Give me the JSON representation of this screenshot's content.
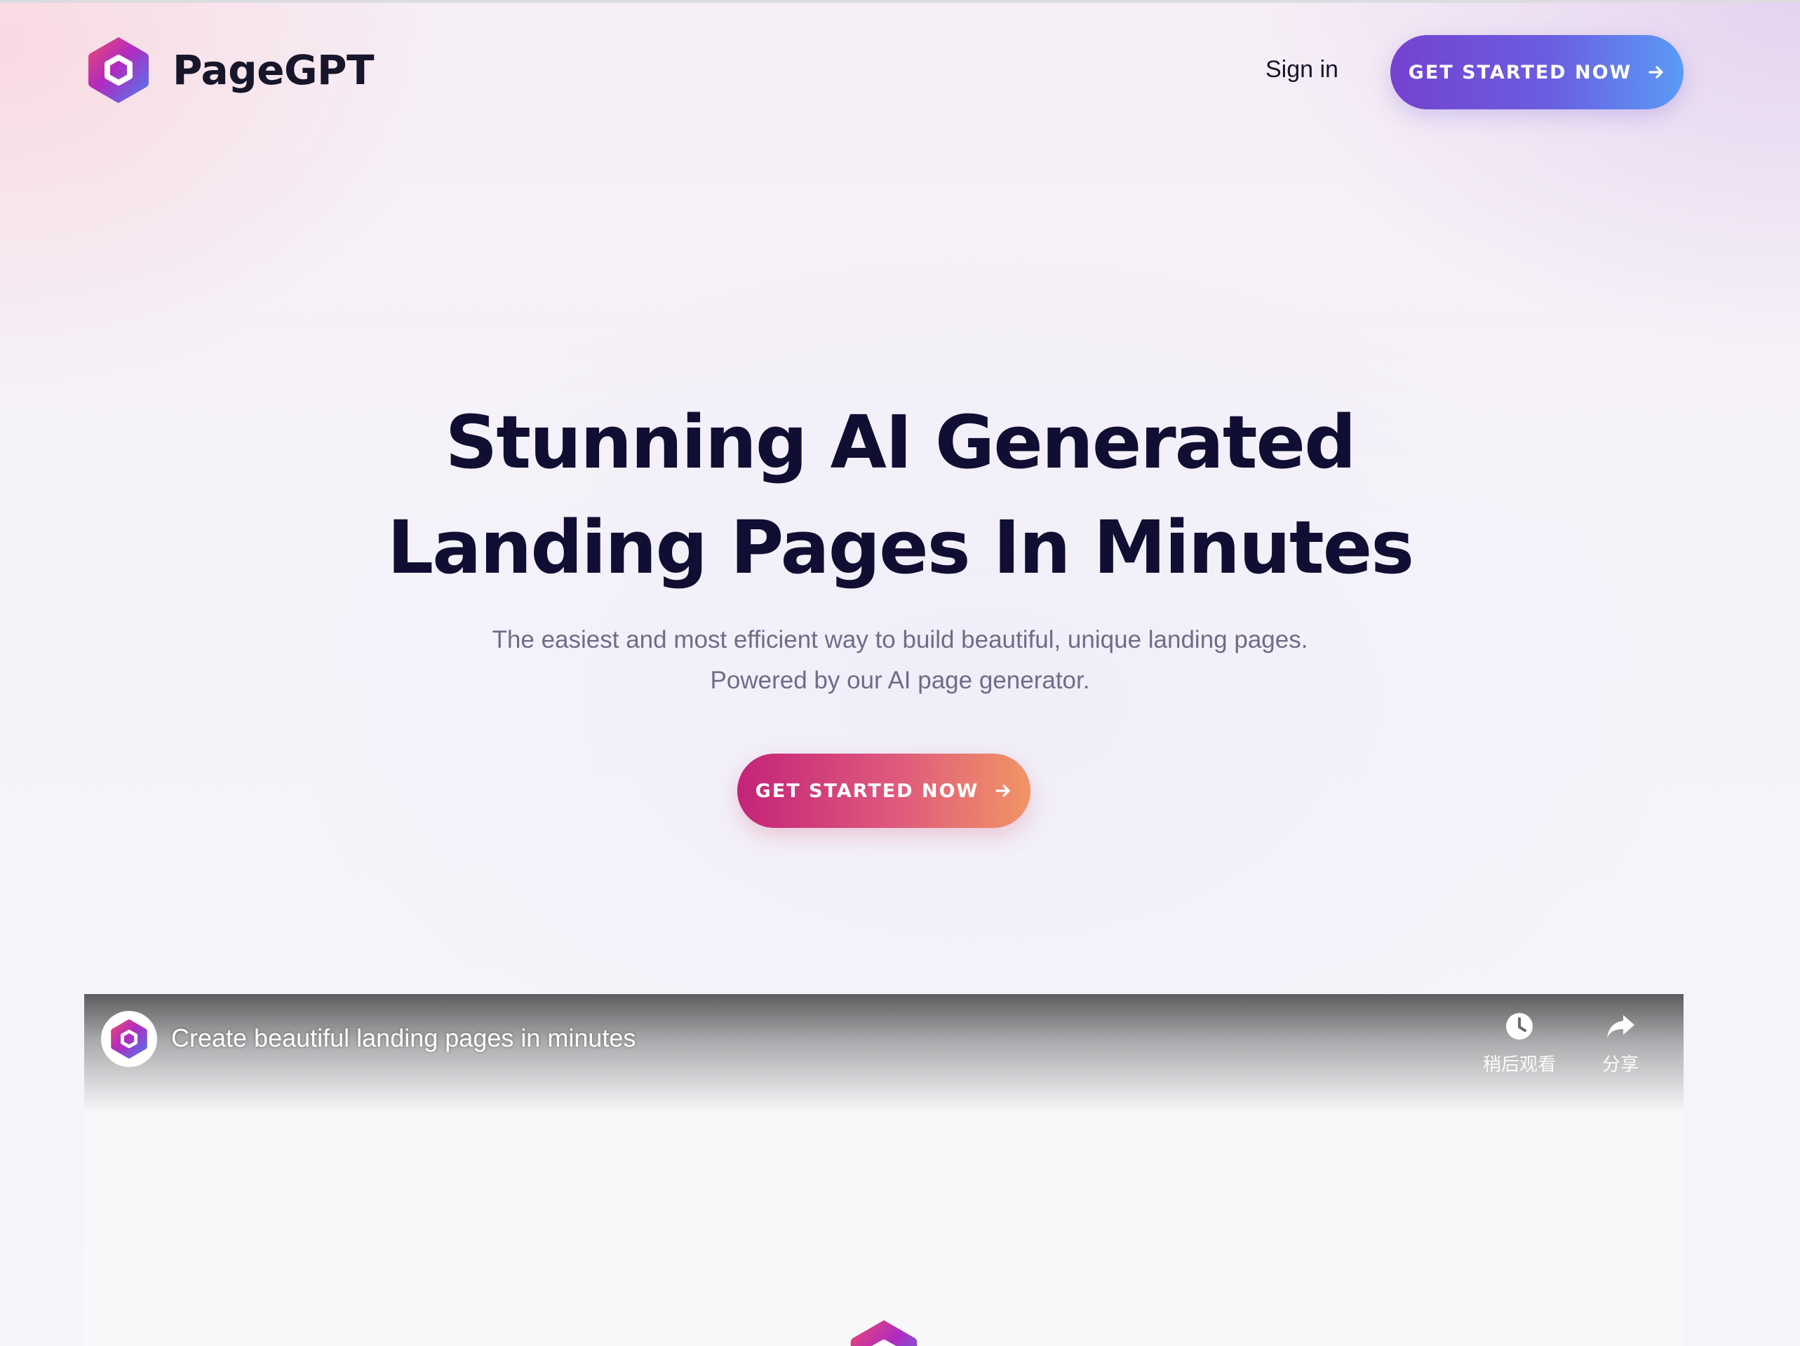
{
  "brand": {
    "name": "PageGPT"
  },
  "nav": {
    "sign_in": "Sign in",
    "cta": "GET STARTED NOW"
  },
  "hero": {
    "title_line1": "Stunning AI Generated",
    "title_line2": "Landing Pages In Minutes",
    "subtitle_line1": "The easiest and most efficient way to build beautiful, unique landing pages.",
    "subtitle_line2": "Powered by our AI page generator.",
    "cta": "GET STARTED NOW"
  },
  "video": {
    "title": "Create beautiful landing pages in minutes",
    "watch_later_label": "稍后观看",
    "share_label": "分享"
  },
  "icons": {
    "logo": "hexagon-logo-icon",
    "arrow": "arrow-right-icon",
    "clock": "clock-icon",
    "share": "share-arrow-icon"
  },
  "colors": {
    "heading": "#110e33",
    "subtitle": "#6e6d87",
    "nav_cta_gradient": [
      "#7542cf",
      "#5b9bf7"
    ],
    "hero_cta_gradient": [
      "#c42378",
      "#f19566"
    ]
  }
}
